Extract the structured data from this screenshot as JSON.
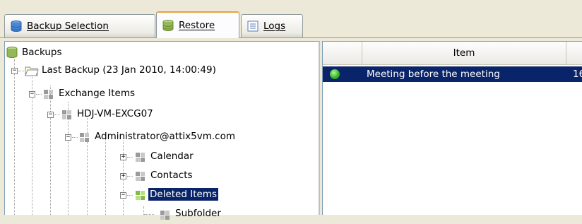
{
  "tabs": [
    {
      "label": "Backup Selection",
      "icon": "database-icon",
      "active": false
    },
    {
      "label": "Restore",
      "icon": "database-restore-icon",
      "active": true
    },
    {
      "label": "Logs",
      "icon": "log-document-icon",
      "active": false
    }
  ],
  "tree": {
    "root": "Backups",
    "last_backup": "Last Backup (23 Jan 2010, 14:00:49)",
    "exchange_items": "Exchange Items",
    "server": "HDJ-VM-EXCG07",
    "mailbox": "Administrator@attix5vm.com",
    "calendar": "Calendar",
    "contacts": "Contacts",
    "deleted_items": "Deleted Items",
    "subfolder": "Subfolder"
  },
  "grid": {
    "columns": [
      "",
      "Item",
      ""
    ],
    "rows": [
      {
        "status": "green-status-icon",
        "item": "Meeting before the meeting",
        "extra": "16"
      }
    ]
  },
  "colors": {
    "selection": "#0a246a",
    "tab_highlight": "#e7a13e",
    "status_green": "#36b82c"
  }
}
